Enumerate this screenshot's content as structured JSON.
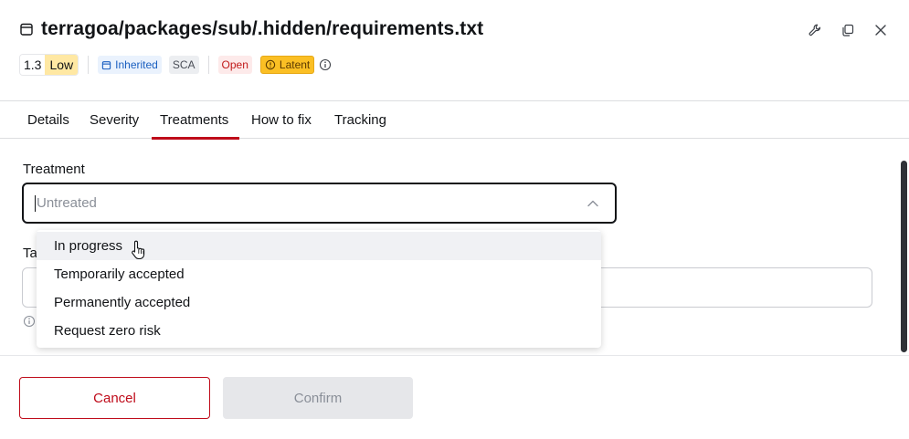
{
  "header": {
    "title": "terragoa/packages/sub/.hidden/requirements.txt",
    "file_icon": "file-icon",
    "actions": [
      {
        "name": "wrench-icon"
      },
      {
        "name": "copy-icon"
      },
      {
        "name": "close-icon"
      }
    ]
  },
  "badges": {
    "score": "1.3",
    "severity": "Low",
    "inherited": "Inherited",
    "technique": "SCA",
    "status": "Open",
    "latent": "Latent"
  },
  "tabs": [
    {
      "label": "Details"
    },
    {
      "label": "Severity"
    },
    {
      "label": "Treatments"
    },
    {
      "label": "How to fix"
    },
    {
      "label": "Tracking"
    }
  ],
  "active_tab": "Treatments",
  "form": {
    "treatment_label": "Treatment",
    "treatment_placeholder": "Untreated",
    "second_label_visible": "Ta",
    "dropdown_options": [
      {
        "label": "In progress"
      },
      {
        "label": "Temporarily accepted"
      },
      {
        "label": "Permanently accepted"
      },
      {
        "label": "Request zero risk"
      }
    ],
    "hovered_option": "In progress"
  },
  "footer": {
    "cancel_label": "Cancel",
    "confirm_label": "Confirm"
  },
  "colors": {
    "accent": "#bf0b1a",
    "severity_low_bg": "#ffe8a3",
    "inherited_text": "#1a5fc0",
    "latent_bg": "#fbbf24",
    "disabled_bg": "#e6e7ea"
  }
}
